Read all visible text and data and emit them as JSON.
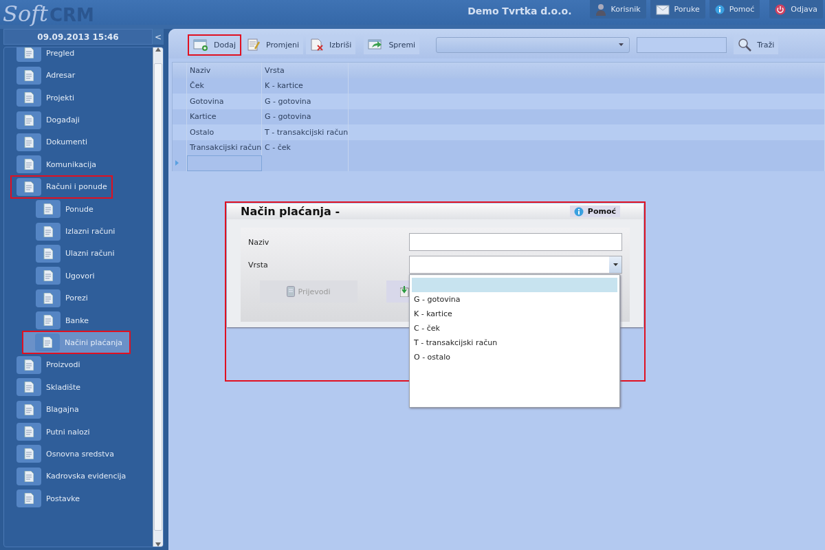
{
  "header": {
    "logo_script": "Soft",
    "logo_bold": "CRM",
    "company": "Demo Tvrtka d.o.o.",
    "actions": [
      {
        "kind": "user",
        "label": "Korisnik"
      },
      {
        "kind": "mail",
        "label": "Poruke"
      },
      {
        "kind": "info",
        "label": "Pomoć"
      },
      {
        "kind": "power",
        "label": "Odjava"
      }
    ]
  },
  "sidebar": {
    "datetime": "09.09.2013 15:46",
    "collapse": "<",
    "items": [
      {
        "label": "Pregled",
        "selected": false,
        "annotated": false
      },
      {
        "label": "Adresar",
        "selected": false,
        "annotated": false
      },
      {
        "label": "Projekti",
        "selected": false,
        "annotated": false
      },
      {
        "label": "Događaji",
        "selected": false,
        "annotated": false
      },
      {
        "label": "Dokumenti",
        "selected": false,
        "annotated": false
      },
      {
        "label": "Komunikacija",
        "selected": false,
        "annotated": false
      },
      {
        "label": "Računi i ponude",
        "selected": false,
        "annotated": true,
        "children": [
          {
            "label": "Ponude",
            "selected": false,
            "annotated": false
          },
          {
            "label": "Izlazni računi",
            "selected": false,
            "annotated": false
          },
          {
            "label": "Ulazni računi",
            "selected": false,
            "annotated": false
          },
          {
            "label": "Ugovori",
            "selected": false,
            "annotated": false
          },
          {
            "label": "Porezi",
            "selected": false,
            "annotated": false
          },
          {
            "label": "Banke",
            "selected": false,
            "annotated": false
          },
          {
            "label": "Načini plaćanja",
            "selected": true,
            "annotated": true
          }
        ]
      },
      {
        "label": "Proizvodi",
        "selected": false,
        "annotated": false
      },
      {
        "label": "Skladište",
        "selected": false,
        "annotated": false
      },
      {
        "label": "Blagajna",
        "selected": false,
        "annotated": false
      },
      {
        "label": "Putni nalozi",
        "selected": false,
        "annotated": false
      },
      {
        "label": "Osnovna sredstva",
        "selected": false,
        "annotated": false
      },
      {
        "label": "Kadrovska evidencija",
        "selected": false,
        "annotated": false
      },
      {
        "label": "Postavke",
        "selected": false,
        "annotated": false
      }
    ]
  },
  "toolbar": {
    "buttons": [
      {
        "kind": "add",
        "label": "Dodaj",
        "annotated": true
      },
      {
        "kind": "edit",
        "label": "Promjeni",
        "annotated": false
      },
      {
        "kind": "delete",
        "label": "Izbriši",
        "annotated": false
      },
      {
        "kind": "save",
        "label": "Spremi",
        "annotated": false
      }
    ],
    "search_button": "Traži"
  },
  "table": {
    "columns": [
      "Naziv",
      "Vrsta"
    ],
    "rows": [
      [
        "Ček",
        "K - kartice"
      ],
      [
        "Gotovina",
        "G - gotovina"
      ],
      [
        "Kartice",
        "G - gotovina"
      ],
      [
        "Ostalo",
        "T - transakcijski račun"
      ],
      [
        "Transakcijski račun",
        "C - ček"
      ]
    ],
    "new_row_current": true
  },
  "dialog": {
    "title": "Način plaćanja -",
    "help": "Pomoć",
    "annotated": true,
    "fields": [
      {
        "kind": "text",
        "label": "Naziv"
      },
      {
        "kind": "select",
        "label": "Vrsta"
      }
    ],
    "buttons": [
      {
        "label": "Prijevodi",
        "disabled": true
      }
    ],
    "dropdown": {
      "blank_option_selected": true,
      "options": [
        {
          "label": "G - gotovina",
          "selected": false
        },
        {
          "label": "K - kartice",
          "selected": false
        },
        {
          "label": "C - ček",
          "selected": false
        },
        {
          "label": "T - transakcijski račun",
          "selected": false
        },
        {
          "label": "O - ostalo",
          "selected": false
        }
      ]
    }
  }
}
